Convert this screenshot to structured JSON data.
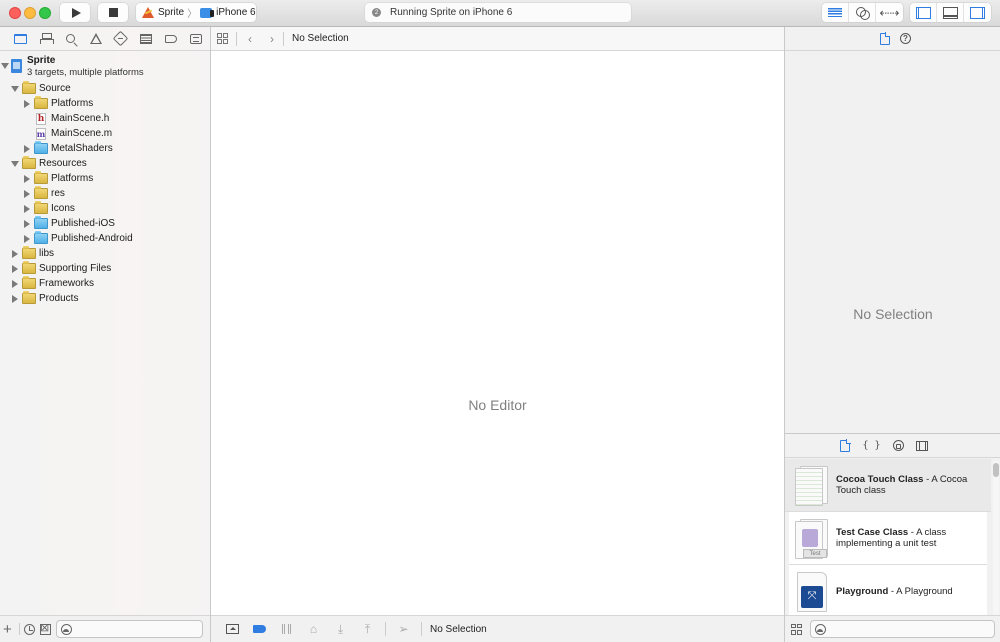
{
  "toolbar": {
    "scheme_name": "Sprite",
    "scheme_separator": "〉",
    "device_name": "iPhone 6",
    "activity_status": "Running Sprite on iPhone 6",
    "activity_badge": "2"
  },
  "navigator": {
    "tabs": [
      "project-navigator",
      "symbol-navigator",
      "find-navigator",
      "issue-navigator",
      "test-navigator",
      "debug-navigator",
      "breakpoint-navigator",
      "report-navigator"
    ],
    "project": {
      "name": "Sprite",
      "subtitle": "3 targets, multiple platforms"
    },
    "tree": [
      {
        "label": "Source",
        "type": "folder-yellow",
        "level": 1,
        "state": "open"
      },
      {
        "label": "Platforms",
        "type": "folder-yellow",
        "level": 2,
        "state": "closed"
      },
      {
        "label": "MainScene.h",
        "type": "file-h",
        "level": 2,
        "state": "none"
      },
      {
        "label": "MainScene.m",
        "type": "file-m",
        "level": 2,
        "state": "none"
      },
      {
        "label": "MetalShaders",
        "type": "folder-blue",
        "level": 2,
        "state": "closed"
      },
      {
        "label": "Resources",
        "type": "folder-yellow",
        "level": 1,
        "state": "open"
      },
      {
        "label": "Platforms",
        "type": "folder-yellow",
        "level": 2,
        "state": "closed"
      },
      {
        "label": "res",
        "type": "folder-yellow",
        "level": 2,
        "state": "closed"
      },
      {
        "label": "Icons",
        "type": "folder-yellow",
        "level": 2,
        "state": "closed"
      },
      {
        "label": "Published-iOS",
        "type": "folder-blue",
        "level": 2,
        "state": "closed"
      },
      {
        "label": "Published-Android",
        "type": "folder-blue",
        "level": 2,
        "state": "closed"
      },
      {
        "label": "libs",
        "type": "folder-yellow",
        "level": 1,
        "state": "closed"
      },
      {
        "label": "Supporting Files",
        "type": "folder-yellow",
        "level": 1,
        "state": "closed"
      },
      {
        "label": "Frameworks",
        "type": "folder-yellow",
        "level": 1,
        "state": "closed"
      },
      {
        "label": "Products",
        "type": "folder-yellow",
        "level": 1,
        "state": "closed"
      }
    ],
    "footer": {
      "add_label": "+",
      "filter_placeholder": ""
    }
  },
  "editor": {
    "jumpbar_title": "No Selection",
    "empty_message": "No Editor",
    "debug_bar_status": "No Selection"
  },
  "inspector": {
    "empty_message": "No Selection",
    "help_glyph": "?",
    "library": {
      "code_glyph": "{ }",
      "items": [
        {
          "title": "Cocoa Touch Class",
          "desc": " - A Cocoa Touch class",
          "selected": true
        },
        {
          "title": "Test Case Class",
          "desc": " - A class implementing a unit test",
          "thumb_label": "Test",
          "selected": false
        },
        {
          "title": "Playground",
          "desc": " - A Playground",
          "selected": false
        }
      ],
      "filter_placeholder": ""
    }
  },
  "colors": {
    "accent": "#2f7de1",
    "folder_yellow": "#e3c256",
    "folder_blue": "#5fb8ea",
    "placeholder_text": "#808080"
  }
}
